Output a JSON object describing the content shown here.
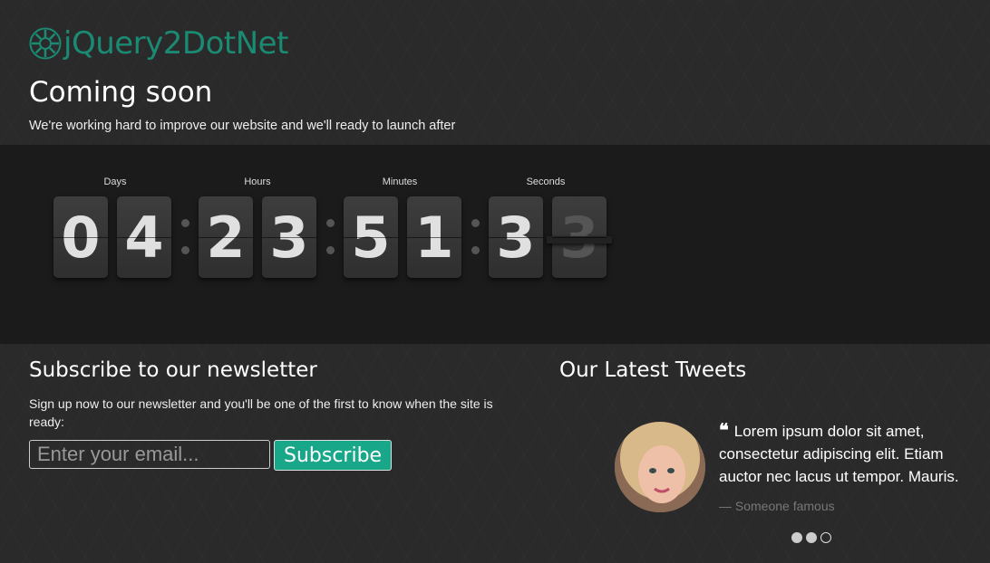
{
  "brand": {
    "name": "jQuery2DotNet",
    "color": "#1a8a72"
  },
  "hero": {
    "title": "Coming soon",
    "subtitle": "We're working hard to improve our website and we'll ready to launch after"
  },
  "countdown": {
    "labels": {
      "days": "Days",
      "hours": "Hours",
      "minutes": "Minutes",
      "seconds": "Seconds"
    },
    "digits": {
      "d1": "0",
      "d2": "4",
      "h1": "2",
      "h2": "3",
      "m1": "5",
      "m2": "1",
      "s1": "3",
      "s2": "3"
    }
  },
  "newsletter": {
    "title": "Subscribe to our newsletter",
    "text": "Sign up now to our newsletter and you'll be one of the first to know when the site is ready:",
    "email_placeholder": "Enter your email...",
    "button_label": "Subscribe",
    "accent": "#19a78a"
  },
  "tweets": {
    "title": "Our Latest Tweets",
    "quote_icon": "❝",
    "quote": "Lorem ipsum dolor sit amet, consectetur adipiscing elit. Etiam auctor nec lacus ut tempor. Mauris.",
    "author": "— Someone famous",
    "carousel_count": 3,
    "active_slide": 3
  }
}
